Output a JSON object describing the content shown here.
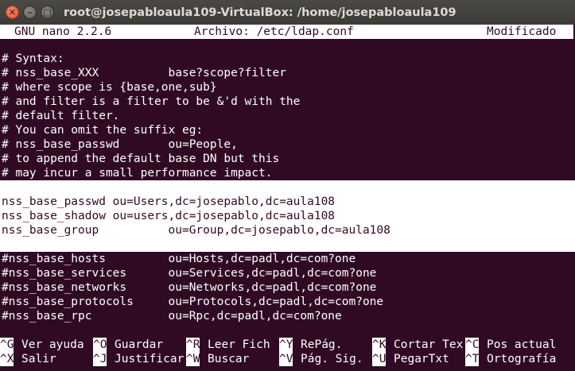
{
  "window": {
    "title": "root@josepabloaula109-VirtualBox: /home/josepabloaula109",
    "close_glyph": "✕",
    "minimize_glyph": "–",
    "maximize_glyph": "□"
  },
  "nano": {
    "version": "GNU nano 2.2.6",
    "file": "Archivo: /etc/ldap.conf",
    "status": "Modificado"
  },
  "editor": {
    "lines": [
      "# Syntax:",
      "# nss_base_XXX          base?scope?filter",
      "# where scope is {base,one,sub}",
      "# and filter is a filter to be &'d with the",
      "# default filter.",
      "# You can omit the suffix eg:",
      "# nss_base_passwd       ou=People,",
      "# to append the default base DN but this",
      "# may incur a small performance impact.",
      "",
      "nss_base_passwd ou=Users,dc=josepablo,dc=aula108",
      "nss_base_shadow ou=users,dc=josepablo,dc=aula108",
      "nss_base_group          ou=Group,dc=josepablo,dc=aula108",
      "",
      "#nss_base_hosts         ou=Hosts,dc=padl,dc=com?one",
      "#nss_base_services      ou=Services,dc=padl,dc=com?one",
      "#nss_base_networks      ou=Networks,dc=padl,dc=com?one",
      "#nss_base_protocols     ou=Protocols,dc=padl,dc=com?one",
      "#nss_base_rpc           ou=Rpc,dc=padl,dc=com?one"
    ]
  },
  "shortcuts": {
    "row1": [
      {
        "key": "^G",
        "label": "Ver ayuda"
      },
      {
        "key": "^O",
        "label": "Guardar"
      },
      {
        "key": "^R",
        "label": "Leer Fich"
      },
      {
        "key": "^Y",
        "label": "RePág."
      },
      {
        "key": "^K",
        "label": "Cortar Tex"
      },
      {
        "key": "^C",
        "label": "Pos actual"
      }
    ],
    "row2": [
      {
        "key": "^X",
        "label": "Salir"
      },
      {
        "key": "^J",
        "label": "Justificar"
      },
      {
        "key": "^W",
        "label": "Buscar"
      },
      {
        "key": "^V",
        "label": "Pág. Sig."
      },
      {
        "key": "^U",
        "label": "PegarTxt"
      },
      {
        "key": "^T",
        "label": "Ortografía"
      }
    ]
  }
}
